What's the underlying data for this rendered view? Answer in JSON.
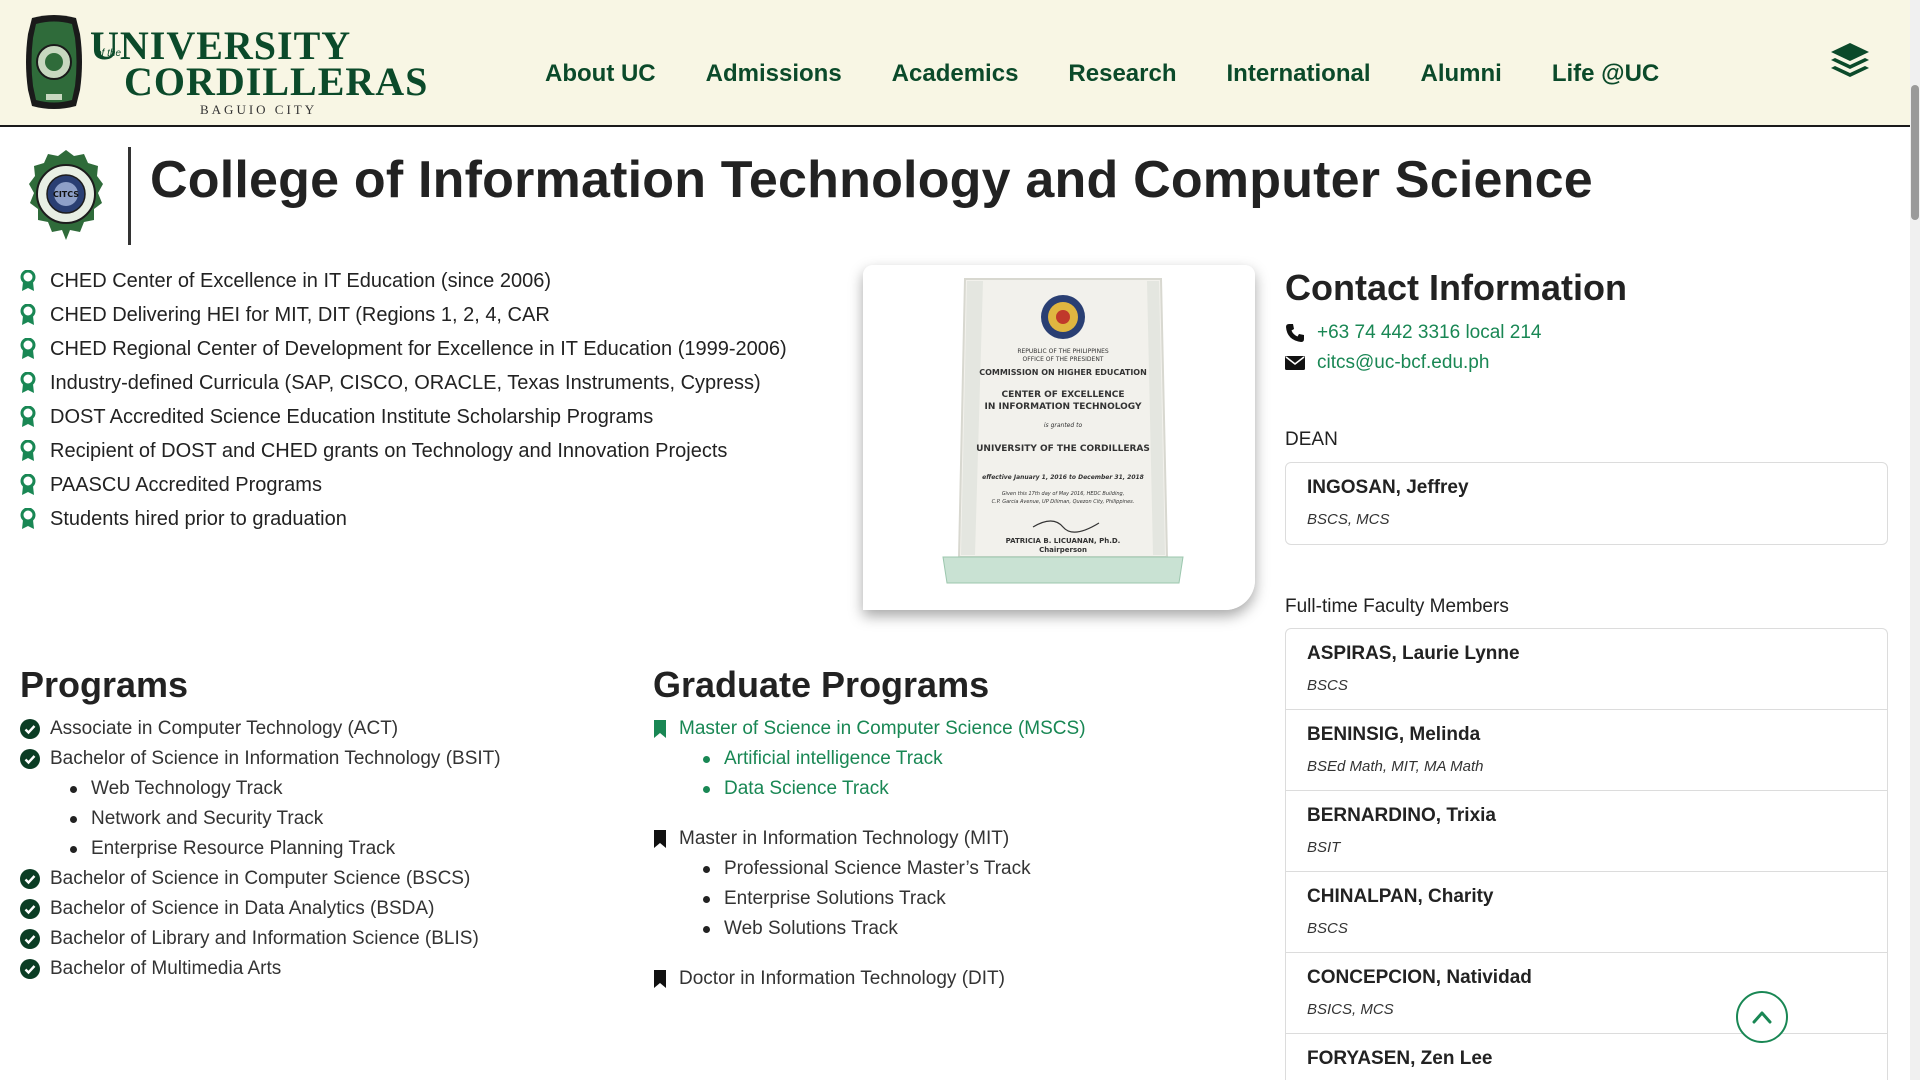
{
  "header": {
    "logo": {
      "line1": "UNIVERSITY",
      "ofthe": "of the",
      "line2": "CORDILLERAS",
      "city": "BAGUIO CITY"
    },
    "nav": [
      "About UC",
      "Admissions",
      "Academics",
      "Research",
      "International",
      "Alumni",
      "Life @UC"
    ],
    "menu_icon": "layers-icon",
    "brand_color": "#0b4a2a"
  },
  "page": {
    "title": "College of Information Technology and Computer Science",
    "seal_label": "CITCS"
  },
  "achievements": [
    "CHED Center of Excellence in IT Education (since 2006)",
    "CHED Delivering HEI for MIT, DIT (Regions 1, 2, 4, CAR",
    "CHED Regional Center of Development for Excellence in IT Education (1999-2006)",
    "Industry-defined Curricula (SAP, CISCO, ORACLE, Texas Instruments, Cypress)",
    "DOST Accredited Science Education Institute Scholarship Programs",
    "Recipient of DOST and CHED grants on Technology and Innovation Projects",
    "PAASCU Accredited Programs",
    "Students hired prior to graduation"
  ],
  "award": {
    "l1": "REPUBLIC OF THE PHILIPPINES",
    "l2": "OFFICE OF THE PRESIDENT",
    "l3": "COMMISSION ON HIGHER EDUCATION",
    "l4": "CENTER OF EXCELLENCE",
    "l5": "IN INFORMATION TECHNOLOGY",
    "l6": "is granted to",
    "l7": "UNIVERSITY OF THE CORDILLERAS",
    "l8": "effective January 1, 2016 to December 31, 2018",
    "l9": "Given this 17th day of May 2016, HEDC Building,",
    "l10": "C.P. Garcia Avenue, UP Diliman, Quezon City, Philippines.",
    "l11": "PATRICIA B. LICUANAN, Ph.D.",
    "l12": "Chairperson"
  },
  "programs": {
    "title": "Programs",
    "items": {
      "act": "Associate in Computer Technology (ACT)",
      "bsit": "Bachelor of Science in Information Technology (BSIT)",
      "bsit_tracks": [
        "Web Technology Track",
        "Network and Security Track",
        "Enterprise Resource Planning Track"
      ],
      "bscs": "Bachelor of Science in Computer Science (BSCS)",
      "bsda": "Bachelor of Science in Data Analytics (BSDA)",
      "blis": "Bachelor of Library and Information Science (BLIS)",
      "bma": "Bachelor of Multimedia Arts"
    }
  },
  "graduate": {
    "title": "Graduate Programs",
    "mscs": "Master of Science in Computer Science (MSCS)",
    "mscs_tracks": [
      "Artificial intelligence Track",
      "Data Science Track"
    ],
    "mit": "Master in Information Technology (MIT)",
    "mit_tracks": [
      "Professional Science Master’s Track",
      "Enterprise Solutions Track",
      "Web Solutions Track"
    ],
    "dit": "Doctor in Information Technology (DIT)"
  },
  "contact": {
    "title": "Contact Information",
    "phone": "+63 74 442 3316 local 214",
    "email": "citcs@uc-bcf.edu.ph",
    "accent": "#198754"
  },
  "dean": {
    "label": "DEAN",
    "name": "INGOSAN, Jeffrey",
    "degree": "BSCS, MCS"
  },
  "faculty": {
    "label": "Full-time Faculty Members",
    "members": [
      {
        "name": "ASPIRAS, Laurie Lynne",
        "degree": "BSCS"
      },
      {
        "name": "BENINSIG, Melinda",
        "degree": "BSEd Math, MIT, MA Math"
      },
      {
        "name": "BERNARDINO, Trixia",
        "degree": "BSIT"
      },
      {
        "name": "CHINALPAN, Charity",
        "degree": "BSCS"
      },
      {
        "name": "CONCEPCION, Natividad",
        "degree": "BSICS, MCS"
      },
      {
        "name": "FORYASEN, Zen Lee",
        "degree": ""
      }
    ]
  }
}
